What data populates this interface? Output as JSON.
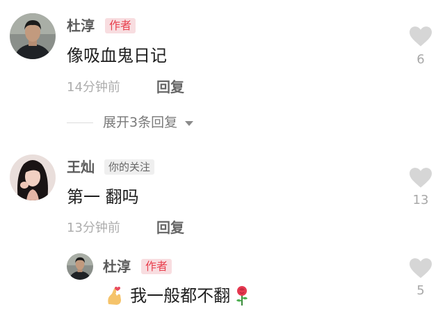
{
  "comments": [
    {
      "username": "杜淳",
      "badge": "作者",
      "text": "像吸血鬼日记",
      "time": "14分钟前",
      "reply_label": "回复",
      "likes": "6",
      "expand_label": "展开3条回复",
      "avatar_icon": "man-portrait-avatar"
    },
    {
      "username": "王灿",
      "badge": "你的关注",
      "text": "第一 翻吗",
      "time": "13分钟前",
      "reply_label": "回复",
      "likes": "13",
      "avatar_icon": "woman-portrait-avatar"
    }
  ],
  "reply": {
    "username": "杜淳",
    "badge": "作者",
    "text": "我一般都不翻",
    "leading_emoji": "finger-heart-emoji",
    "trailing_emoji": "rose-emoji",
    "likes": "5"
  },
  "colors": {
    "author_badge_bg": "#f8dde0",
    "author_badge_text": "#e8404e",
    "like_icon": "#d6d6d6"
  }
}
